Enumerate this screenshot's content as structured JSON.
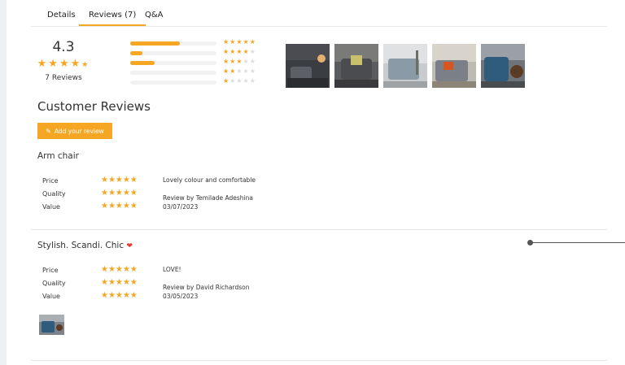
{
  "tabs": [
    {
      "label": "Details"
    },
    {
      "label": "Reviews (7)"
    },
    {
      "label": "Q&A"
    }
  ],
  "summary": {
    "average": "4.3",
    "stars": "★★★★",
    "half_star": "½",
    "count_text": "7 Reviews"
  },
  "distribution": [
    {
      "stars": 5,
      "fraction": 0.58
    },
    {
      "stars": 4,
      "fraction": 0.14
    },
    {
      "stars": 3,
      "fraction": 0.28
    },
    {
      "stars": 2,
      "fraction": 0
    },
    {
      "stars": 1,
      "fraction": 0
    }
  ],
  "gallery_count": 5,
  "reviews_section": {
    "title": "Customer Reviews",
    "add_button": "Add your review"
  },
  "reviews": [
    {
      "title": "Arm chair",
      "price_label": "Price",
      "quality_label": "Quality",
      "value_label": "Value",
      "price_stars": "★★★★★",
      "quality_stars": "★★★★★",
      "value_stars": "★★★★★",
      "text": "Lovely colour and comfortable",
      "byline": "Review by Temilade Adeshina",
      "date": "03/07/2023"
    },
    {
      "title": "Stylish. Scandi. Chic",
      "heart": "❤",
      "price_label": "Price",
      "quality_label": "Quality",
      "value_label": "Value",
      "price_stars": "★★★★★",
      "quality_stars": "★★★★★",
      "value_stars": "★★★★★",
      "text": "LOVE!",
      "byline": "Review by David Richardson",
      "date": "03/05/2023"
    }
  ],
  "colors": {
    "accent": "#f5a623",
    "heart": "#e53935"
  }
}
